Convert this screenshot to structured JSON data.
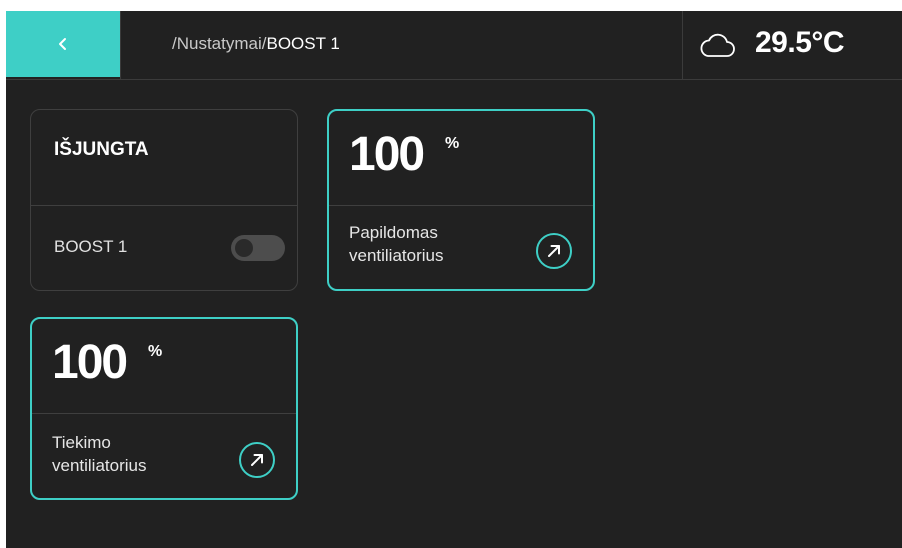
{
  "header": {
    "back_icon": "chevron-left-icon",
    "breadcrumb_parent": "/Nustatymai/",
    "breadcrumb_current": "BOOST 1",
    "weather_icon": "cloud-icon",
    "temperature": "29.5°C"
  },
  "boost_card": {
    "status": "IŠJUNGTA",
    "label": "BOOST 1",
    "toggle_on": false
  },
  "fan_cards": [
    {
      "value": "100",
      "unit": "%",
      "label_line1": "Papildomas",
      "label_line2": "ventiliatorius",
      "icon": "arrow-up-right-icon"
    },
    {
      "value": "100",
      "unit": "%",
      "label_line1": "Tiekimo",
      "label_line2": "ventiliatorius",
      "icon": "arrow-up-right-icon"
    }
  ],
  "colors": {
    "accent": "#3ecfc6",
    "background": "#212121",
    "text": "#ffffff"
  }
}
